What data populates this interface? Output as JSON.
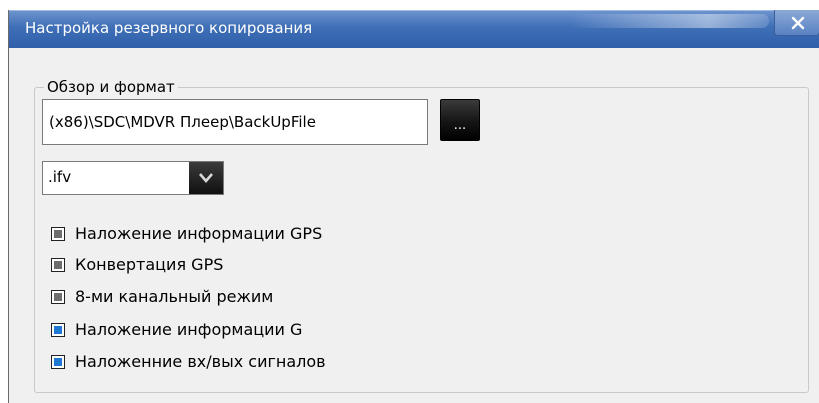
{
  "window": {
    "title": "Настройка резервного копирования",
    "close_symbol": "✕"
  },
  "group": {
    "legend": "Обзор и формат",
    "path_value": "(x86)\\SDC\\MDVR Плеер\\BackUpFile",
    "browse_label": "...",
    "format_value": ".ifv"
  },
  "options": [
    {
      "label": "Наложение информации GPS",
      "checked": false
    },
    {
      "label": "Конвертация GPS",
      "checked": false
    },
    {
      "label": "8-ми канальный режим",
      "checked": false
    },
    {
      "label": "Наложение информации G",
      "checked": true
    },
    {
      "label": "Наложенние вх/вых сигналов",
      "checked": true
    }
  ],
  "colors": {
    "checked_fill": "#1e78d2",
    "unchecked_fill": "#6e6e6e",
    "title_bar": "#3f6fb7"
  },
  "icons": {
    "close": "close-icon",
    "dropdown": "chevron-down-icon"
  }
}
